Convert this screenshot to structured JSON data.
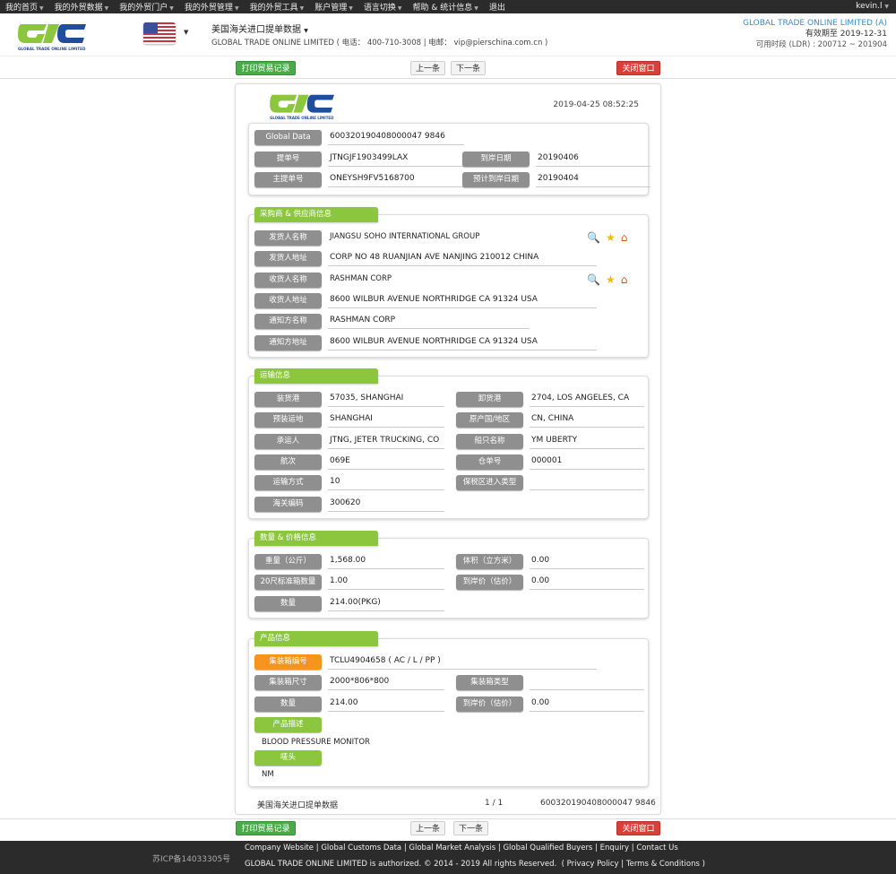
{
  "topnav": {
    "items": [
      "我的首页",
      "我的外贸数据",
      "我的外贸门户",
      "我的外贸管理",
      "我的外贸工具",
      "账户管理",
      "语言切换",
      "帮助 & 统计信息",
      "退出"
    ],
    "user": "kevin.l"
  },
  "header": {
    "logo_text": "GLOBAL TRADE ONLINE LIMITED",
    "title": "美国海关进口提单数据",
    "subtitle": "GLOBAL TRADE ONLINE LIMITED ( 电话： 400-710-3008 | 电邮： vip@pierschina.com.cn )",
    "company": "GLOBAL TRADE ONLINE LIMITED (A)",
    "expiry": "有效期至 2019-12-31",
    "ldr": "可用时段 (LDR) : 200712 ~ 201904"
  },
  "actions": {
    "print": "打印贸易记录",
    "prev": "上一条",
    "next": "下一条",
    "close": "关闭窗口"
  },
  "document": {
    "timestamp": "2019-04-25 08:52:25",
    "basic": {
      "global_data_label": "Global Data",
      "global_data": "600320190408000047 9846",
      "bill_label": "提单号",
      "bill": "JTNGJF1903499LAX",
      "arrival_label": "到岸日期",
      "arrival": "20190406",
      "master_label": "主提单号",
      "master": "ONEYSH9FV5168700",
      "est_arrival_label": "预计到岸日期",
      "est_arrival": "20190404"
    },
    "parties": {
      "title": "采购商 & 供应商信息",
      "rows": [
        {
          "label": "发货人名称",
          "value": "JIANGSU SOHO INTERNATIONAL GROUP"
        },
        {
          "label": "发货人地址",
          "value": "CORP NO 48 RUANJIAN AVE NANJING 210012 CHINA"
        },
        {
          "label": "收货人名称",
          "value": "RASHMAN CORP"
        },
        {
          "label": "收货人地址",
          "value": "8600 WILBUR AVENUE NORTHRIDGE CA 91324 USA"
        },
        {
          "label": "通知方名称",
          "value": "RASHMAN CORP"
        },
        {
          "label": "通知方地址",
          "value": "8600 WILBUR AVENUE NORTHRIDGE CA 91324 USA"
        }
      ]
    },
    "shipping": {
      "title": "运输信息",
      "rows": [
        {
          "l1": "装货港",
          "v1": "57035, SHANGHAI",
          "l2": "卸货港",
          "v2": "2704, LOS ANGELES, CA"
        },
        {
          "l1": "预装运地",
          "v1": "SHANGHAI",
          "l2": "原产国/地区",
          "v2": "CN, CHINA"
        },
        {
          "l1": "承运人",
          "v1": "JTNG, JETER TRUCKING, CO",
          "l2": "船只名称",
          "v2": "YM UBERTY"
        },
        {
          "l1": "航次",
          "v1": "069E",
          "l2": "仓单号",
          "v2": "000001"
        },
        {
          "l1": "运输方式",
          "v1": "10",
          "l2": "保税区进入类型",
          "v2": ""
        },
        {
          "l1": "海关编码",
          "v1": "300620"
        }
      ]
    },
    "quantity": {
      "title": "数量 & 价格信息",
      "rows": [
        {
          "l1": "重量（公斤）",
          "v1": "1,568.00",
          "l2": "体积（立方米）",
          "v2": "0.00"
        },
        {
          "l1": "20尺标准箱数量",
          "v1": "1.00",
          "l2": "到岸价（估价）",
          "v2": "0.00"
        },
        {
          "l1": "数量",
          "v1": "214.00(PKG)"
        }
      ]
    },
    "product": {
      "title": "产品信息",
      "container_no_label": "集装箱编号",
      "container_no": "TCLU4904658 ( AC / L / PP )",
      "size_label": "集装箱尺寸",
      "size": "2000*806*800",
      "type_label": "集装箱类型",
      "type": "",
      "qty_label": "数量",
      "qty": "214.00",
      "cif_label": "到岸价（估价）",
      "cif": "0.00",
      "desc_label": "产品描述",
      "desc": "BLOOD PRESSURE MONITOR",
      "marks_label": "唛头",
      "marks": "NM"
    },
    "footer": {
      "source": "美国海关进口提单数据",
      "page": "1 / 1",
      "id": "600320190408000047 9846"
    }
  },
  "site_footer": {
    "icp": "苏ICP备14033305号",
    "links": [
      "Company Website",
      "Global Customs Data",
      "Global Market Analysis",
      "Global Qualified Buyers",
      "Enquiry",
      "Contact Us"
    ],
    "copyright": "GLOBAL TRADE ONLINE LIMITED is authorized. © 2014 - 2019 All rights Reserved.",
    "policy_links": [
      "Privacy Policy",
      "Terms & Conditions"
    ]
  }
}
